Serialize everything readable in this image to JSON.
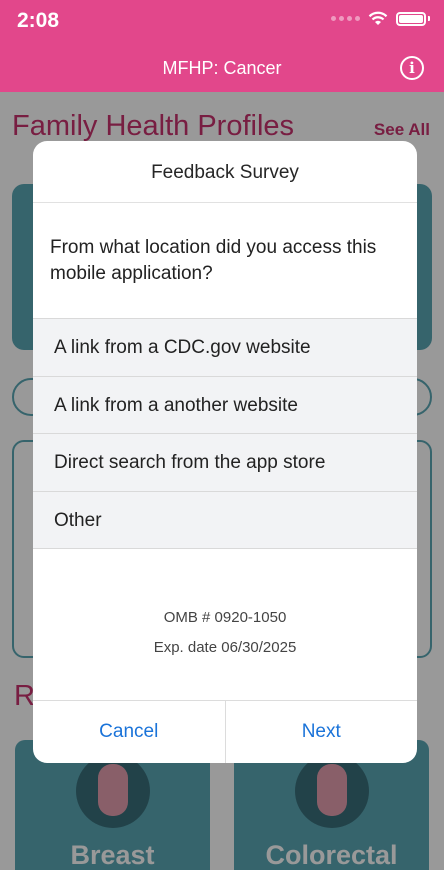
{
  "status_bar": {
    "time": "2:08"
  },
  "header": {
    "title": "MFHP: Cancer"
  },
  "background": {
    "section_title": "Family Health Profiles",
    "see_all": "See All",
    "categories": [
      {
        "label": "Breast"
      },
      {
        "label": "Colorectal"
      }
    ]
  },
  "dialog": {
    "title": "Feedback Survey",
    "question": "From what location did you access this mobile application?",
    "options": [
      "A link from a CDC.gov website",
      "A link from a another website",
      "Direct search from the app store",
      "Other"
    ],
    "omb": "OMB # 0920-1050",
    "expiration": "Exp. date 06/30/2025",
    "cancel_label": "Cancel",
    "next_label": "Next"
  },
  "colors": {
    "header_pink": "#e2478b",
    "teal": "#5aa7b5",
    "accent_text": "#c9336f",
    "link_blue": "#1a73d9"
  }
}
